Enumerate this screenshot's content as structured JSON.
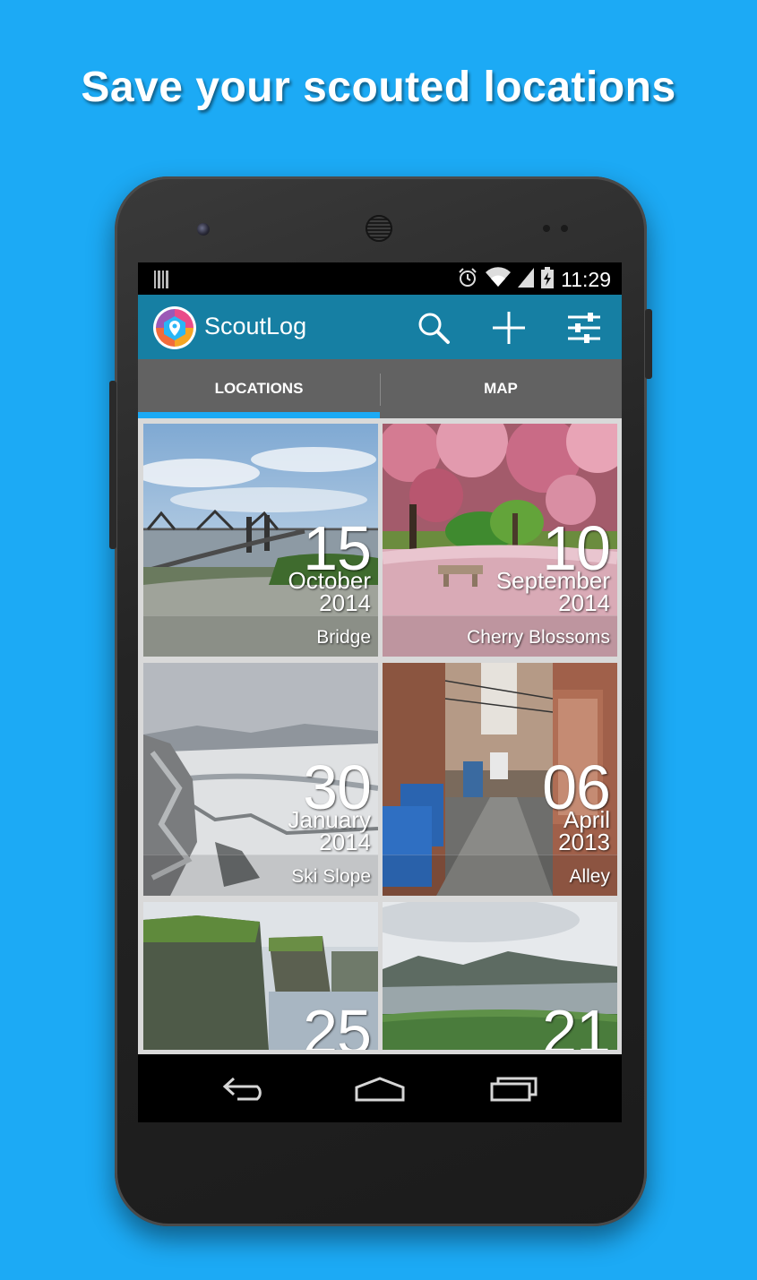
{
  "headline": "Save your scouted locations",
  "status_bar": {
    "time": "11:29",
    "icons": [
      "barcode-icon",
      "alarm-icon",
      "wifi-icon",
      "signal-icon",
      "battery-charging-icon"
    ]
  },
  "app_bar": {
    "title": "ScoutLog",
    "logo": "scoutlog-logo-icon",
    "actions": [
      "search-icon",
      "add-icon",
      "filter-sliders-icon"
    ]
  },
  "tabs": [
    {
      "label": "LOCATIONS",
      "selected": true
    },
    {
      "label": "MAP",
      "selected": false
    }
  ],
  "locations": [
    {
      "day": "15",
      "month": "October",
      "year": "2014",
      "name": "Bridge"
    },
    {
      "day": "10",
      "month": "September",
      "year": "2014",
      "name": "Cherry Blossoms"
    },
    {
      "day": "30",
      "month": "January",
      "year": "2014",
      "name": "Ski Slope"
    },
    {
      "day": "06",
      "month": "April",
      "year": "2013",
      "name": "Alley"
    },
    {
      "day": "25",
      "month": "",
      "year": "",
      "name": ""
    },
    {
      "day": "21",
      "month": "",
      "year": "",
      "name": ""
    }
  ],
  "nav_bar": [
    "back-icon",
    "home-icon",
    "recents-icon"
  ],
  "colors": {
    "background": "#1caaf5",
    "app_bar": "#167fa3",
    "tab_bar": "#626262",
    "tab_indicator": "#1caaf5"
  }
}
